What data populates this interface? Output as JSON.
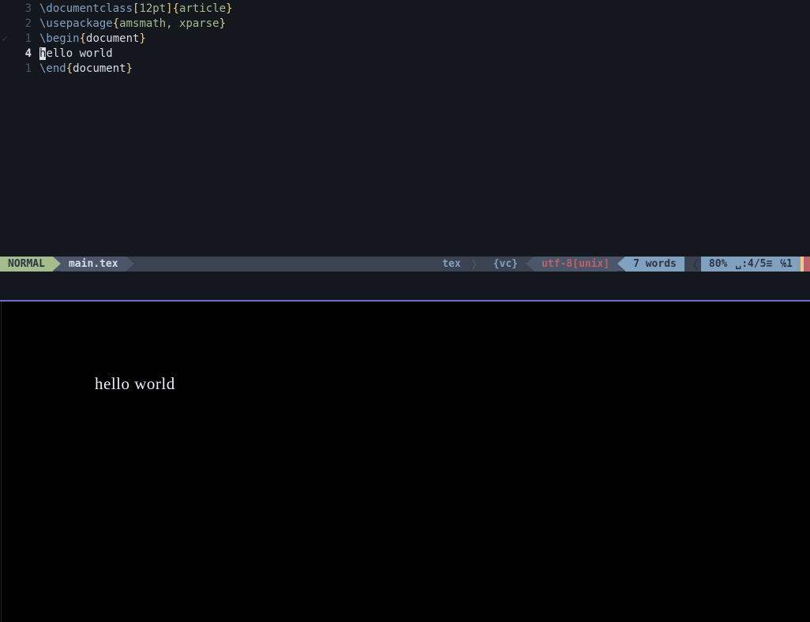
{
  "editor": {
    "lines": [
      {
        "rel": "3",
        "current": false,
        "sign": "",
        "tokens": [
          {
            "t": "\\documentclass",
            "c": "tok-cmd"
          },
          {
            "t": "[",
            "c": "tok-br"
          },
          {
            "t": "12pt",
            "c": "tok-arg"
          },
          {
            "t": "]",
            "c": "tok-br"
          },
          {
            "t": "{",
            "c": "tok-br"
          },
          {
            "t": "article",
            "c": "tok-arg"
          },
          {
            "t": "}",
            "c": "tok-br"
          }
        ]
      },
      {
        "rel": "2",
        "current": false,
        "sign": "",
        "tokens": [
          {
            "t": "\\usepackage",
            "c": "tok-cmd"
          },
          {
            "t": "{",
            "c": "tok-br"
          },
          {
            "t": "amsmath, xparse",
            "c": "tok-arg"
          },
          {
            "t": "}",
            "c": "tok-br"
          }
        ]
      },
      {
        "rel": "1",
        "current": false,
        "sign": "✓",
        "tokens": [
          {
            "t": "\\begin",
            "c": "tok-cmd"
          },
          {
            "t": "{",
            "c": "tok-br"
          },
          {
            "t": "document",
            "c": "tok-env"
          },
          {
            "t": "}",
            "c": "tok-br"
          }
        ]
      },
      {
        "rel": "4",
        "current": true,
        "sign": "",
        "tokens": [
          {
            "t": "h",
            "c": "cursor-block"
          },
          {
            "t": "ello world",
            "c": "tok-txt"
          }
        ]
      },
      {
        "rel": "1",
        "current": false,
        "sign": "",
        "tokens": [
          {
            "t": "\\end",
            "c": "tok-cmd"
          },
          {
            "t": "{",
            "c": "tok-br"
          },
          {
            "t": "document",
            "c": "tok-env"
          },
          {
            "t": "}",
            "c": "tok-br"
          }
        ]
      }
    ]
  },
  "statusline": {
    "mode": "NORMAL",
    "filename": "main.tex",
    "filetype": "tex",
    "vcs": "{vc}",
    "encoding": "utf-8[unix]",
    "words": "7 words",
    "percent": "80%",
    "position": "␣:4/5≡",
    "col": "℅1"
  },
  "preview": {
    "content": "hello world"
  }
}
